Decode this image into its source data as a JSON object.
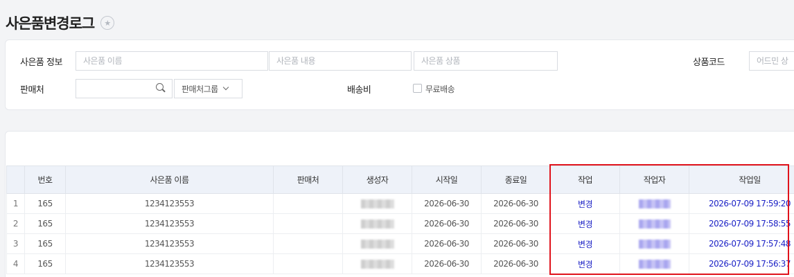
{
  "page": {
    "title": "사은품변경로그"
  },
  "filters": {
    "gift_info_label": "사은품 정보",
    "gift_name_placeholder": "사은품 이름",
    "gift_content_placeholder": "사은품 내용",
    "gift_product_placeholder": "사은품 상품",
    "product_code_label": "상품코드",
    "admin_placeholder": "어드민 상",
    "seller_label": "판매처",
    "seller_value": "",
    "seller_group_label": "판매처그룹",
    "shipping_label": "배송비",
    "free_shipping_label": "무료배송"
  },
  "table": {
    "headers": [
      "번호",
      "사은품 이름",
      "판매처",
      "생성자",
      "시작일",
      "종료일",
      "작업",
      "작업자",
      "작업일"
    ],
    "rows": [
      {
        "idx": "1",
        "no": "165",
        "name": "1234123553",
        "seller": "",
        "start": "2026-06-30",
        "end": "2026-06-30",
        "action": "변경",
        "date": "2026-07-09 17:59:20"
      },
      {
        "idx": "2",
        "no": "165",
        "name": "1234123553",
        "seller": "",
        "start": "2026-06-30",
        "end": "2026-06-30",
        "action": "변경",
        "date": "2026-07-09 17:58:55"
      },
      {
        "idx": "3",
        "no": "165",
        "name": "1234123553",
        "seller": "",
        "start": "2026-06-30",
        "end": "2026-06-30",
        "action": "변경",
        "date": "2026-07-09 17:57:48"
      },
      {
        "idx": "4",
        "no": "165",
        "name": "1234123553",
        "seller": "",
        "start": "2026-06-30",
        "end": "2026-06-30",
        "action": "변경",
        "date": "2026-07-09 17:56:37"
      }
    ]
  },
  "colors": {
    "accent_blue": "#1c22c6",
    "highlight_red": "#e0121b",
    "header_bg": "#eef2f9"
  },
  "icons": {
    "favorite": "star-icon",
    "search": "search-icon",
    "dropdown": "chevron-down-icon"
  }
}
